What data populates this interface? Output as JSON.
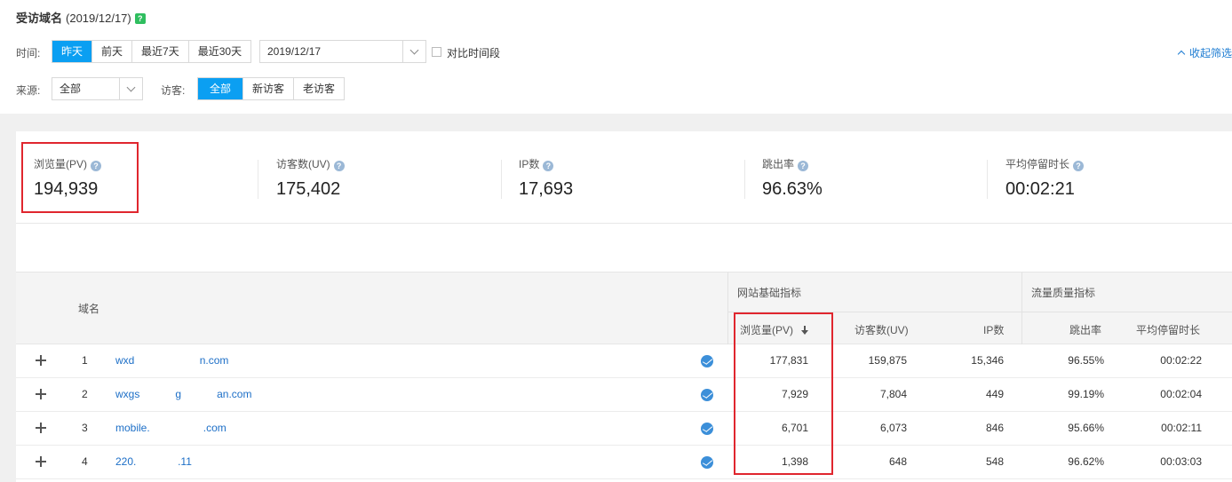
{
  "header": {
    "title": "受访域名",
    "date": "(2019/12/17)",
    "help": "?"
  },
  "filters": {
    "time_label": "时间:",
    "time_buttons": [
      "昨天",
      "前天",
      "最近7天",
      "最近30天"
    ],
    "date_value": "2019/12/17",
    "compare_label": "对比时间段",
    "collapse_label": "收起筛选",
    "source_label": "来源:",
    "source_value": "全部",
    "visitor_label": "访客:",
    "visitor_buttons": [
      "全部",
      "新访客",
      "老访客"
    ]
  },
  "metrics": [
    {
      "label": "浏览量(PV)",
      "value": "194,939"
    },
    {
      "label": "访客数(UV)",
      "value": "175,402"
    },
    {
      "label": "IP数",
      "value": "17,693"
    },
    {
      "label": "跳出率",
      "value": "96.63%"
    },
    {
      "label": "平均停留时长",
      "value": "00:02:21"
    }
  ],
  "table": {
    "col_domain": "域名",
    "group_basic": "网站基础指标",
    "group_quality": "流量质量指标",
    "col_pv": "浏览量(PV)",
    "col_uv": "访客数(UV)",
    "col_ip": "IP数",
    "col_bounce": "跳出率",
    "col_duration": "平均停留时长",
    "rows": [
      {
        "idx": "1",
        "domain": "wxd           n.com",
        "pv": "177,831",
        "uv": "159,875",
        "ip": "15,346",
        "bounce": "96.55%",
        "duration": "00:02:22"
      },
      {
        "idx": "2",
        "domain": "wxgs      g      an.com",
        "pv": "7,929",
        "uv": "7,804",
        "ip": "449",
        "bounce": "99.19%",
        "duration": "00:02:04"
      },
      {
        "idx": "3",
        "domain": "mobile.         .com",
        "pv": "6,701",
        "uv": "6,073",
        "ip": "846",
        "bounce": "95.66%",
        "duration": "00:02:11"
      },
      {
        "idx": "4",
        "domain": "220.       .11",
        "pv": "1,398",
        "uv": "648",
        "ip": "548",
        "bounce": "96.62%",
        "duration": "00:03:03"
      }
    ]
  }
}
